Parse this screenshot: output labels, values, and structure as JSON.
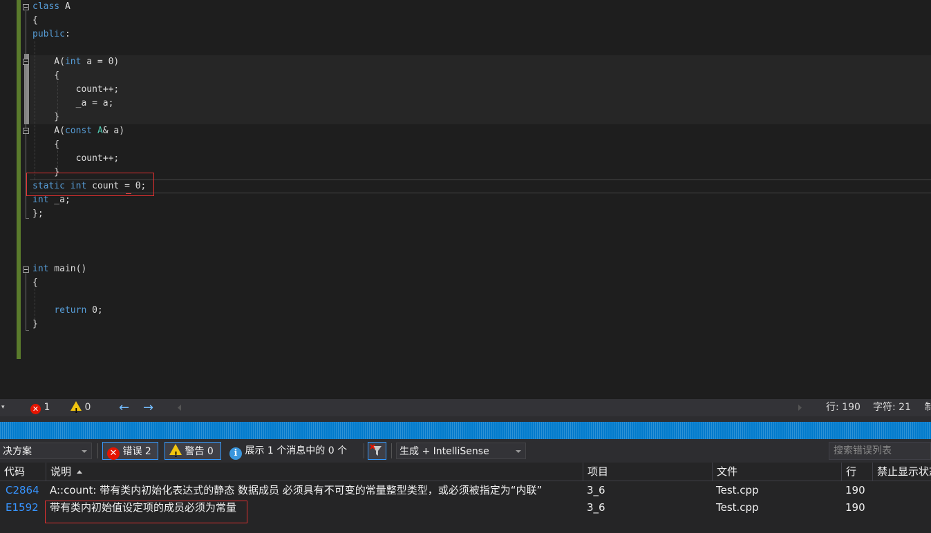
{
  "editor": {
    "lines": [
      {
        "segments": [
          {
            "t": "class",
            "c": "kw"
          },
          {
            "t": " A"
          }
        ]
      },
      {
        "segments": [
          {
            "t": "{"
          }
        ]
      },
      {
        "segments": [
          {
            "t": "public",
            "c": "kw"
          },
          {
            "t": ":"
          }
        ]
      },
      {
        "segments": [
          {
            "t": ""
          }
        ]
      },
      {
        "segments": [
          {
            "t": "    A("
          },
          {
            "t": "int",
            "c": "kw"
          },
          {
            "t": " a = 0)"
          }
        ]
      },
      {
        "segments": [
          {
            "t": "    {"
          }
        ]
      },
      {
        "segments": [
          {
            "t": "        count++;"
          }
        ]
      },
      {
        "segments": [
          {
            "t": "        _a = a;"
          }
        ]
      },
      {
        "segments": [
          {
            "t": "    }"
          }
        ]
      },
      {
        "segments": [
          {
            "t": "    A("
          },
          {
            "t": "const",
            "c": "kw"
          },
          {
            "t": " "
          },
          {
            "t": "A",
            "c": "ty"
          },
          {
            "t": "& a)"
          }
        ]
      },
      {
        "segments": [
          {
            "t": "    {"
          }
        ]
      },
      {
        "segments": [
          {
            "t": "        count++;"
          }
        ]
      },
      {
        "segments": [
          {
            "t": "    }"
          }
        ]
      },
      {
        "segments": [
          {
            "t": "static",
            "c": "kw"
          },
          {
            "t": " "
          },
          {
            "t": "int",
            "c": "kw"
          },
          {
            "t": " count = 0;"
          }
        ]
      },
      {
        "segments": [
          {
            "t": "int",
            "c": "kw"
          },
          {
            "t": " _a;"
          }
        ]
      },
      {
        "segments": [
          {
            "t": "};"
          }
        ]
      },
      {
        "segments": [
          {
            "t": ""
          }
        ]
      },
      {
        "segments": [
          {
            "t": ""
          }
        ]
      },
      {
        "segments": [
          {
            "t": ""
          }
        ]
      },
      {
        "segments": [
          {
            "t": "int",
            "c": "kw"
          },
          {
            "t": " main()"
          }
        ]
      },
      {
        "segments": [
          {
            "t": "{"
          }
        ]
      },
      {
        "segments": [
          {
            "t": ""
          }
        ]
      },
      {
        "segments": [
          {
            "t": "    "
          },
          {
            "t": "return",
            "c": "kw"
          },
          {
            "t": " 0;"
          }
        ]
      },
      {
        "segments": [
          {
            "t": "}"
          }
        ]
      }
    ]
  },
  "status": {
    "error_count": "1",
    "warning_count": "0",
    "back_arrow": "←",
    "forward_arrow": "→",
    "line_label": "行: 190",
    "char_label": "字符: 21",
    "truncated": "制"
  },
  "toolbar": {
    "scope_value": "决方案",
    "errors_label": "错误 2",
    "warnings_label": "警告 0",
    "messages_label": "展示 1 个消息中的 0 个",
    "build_filter_value": "生成 + IntelliSense",
    "search_placeholder": "搜索错误列表"
  },
  "error_list": {
    "headers": {
      "code": "代码",
      "description": "说明",
      "project": "项目",
      "file": "文件",
      "line": "行",
      "suppression": "禁止显示状态"
    },
    "rows": [
      {
        "code": "C2864",
        "description": "A::count: 带有类内初始化表达式的静态 数据成员 必须具有不可变的常量整型类型，或必须被指定为“内联”",
        "project": "3_6",
        "file": "Test.cpp",
        "line": "190"
      },
      {
        "code": "E1592",
        "description": "带有类内初始值设定项的成员必须为常量",
        "project": "3_6",
        "file": "Test.cpp",
        "line": "190"
      }
    ]
  },
  "colors": {
    "keyword": "#569cd6",
    "type": "#4ec9b0",
    "accent_blue": "#007acc",
    "error_red": "#e51400",
    "warning_yellow": "#f1c40f",
    "error_code_link": "#3794ff"
  }
}
